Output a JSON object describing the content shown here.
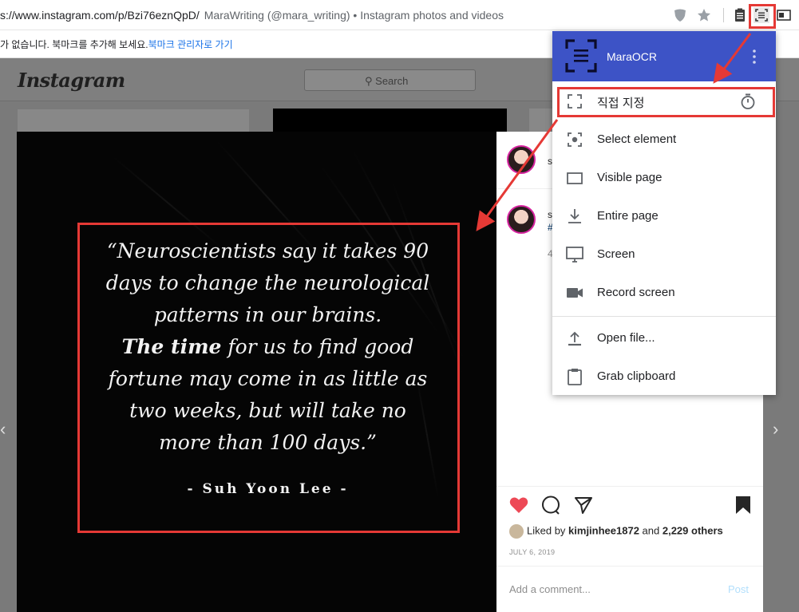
{
  "browser": {
    "url": "s://www.instagram.com/p/Bzi76eznQpD/",
    "page_title": "MaraWriting (@mara_writing) • Instagram photos and videos",
    "bookmark_message": "가 없습니다. 북마크를 추가해 보세요.",
    "bookmark_link": "북마크 관리자로 가기",
    "icons": [
      "shield-icon",
      "star-icon",
      "clipboard-icon",
      "maraocr-extension-icon",
      "window-icon"
    ]
  },
  "instagram": {
    "logo": "Instagram",
    "search_placeholder": "Search",
    "quote": {
      "line1": "“Neuroscientists say it takes 90",
      "line2": "days to change the neurological",
      "line3": "patterns in our brains.",
      "line4_bold": "The time",
      "line4_rest": " for us to find good",
      "line5": "fortune may come in as little as",
      "line6": "two weeks, but will take no",
      "line7": "more than 100 days.”",
      "author": "- Suh Yoon Lee -"
    },
    "side": {
      "user_initial_1": "s",
      "user_initial_2": "s",
      "hashtag_initial": "#",
      "count_initial": "4"
    },
    "likes": {
      "prefix": "Liked by ",
      "user": "kimjinhee1872",
      "middle": " and ",
      "count": "2,229 others"
    },
    "date": "JULY 6, 2019",
    "comment_placeholder": "Add a comment...",
    "post_button": "Post"
  },
  "popup": {
    "title": "MaraOCR",
    "items": [
      {
        "label": "직접 지정",
        "icon": "select-region-icon"
      },
      {
        "label": "Select element",
        "icon": "select-element-icon"
      },
      {
        "label": "Visible page",
        "icon": "visible-page-icon"
      },
      {
        "label": "Entire page",
        "icon": "download-icon"
      },
      {
        "label": "Screen",
        "icon": "monitor-icon"
      },
      {
        "label": "Record screen",
        "icon": "video-camera-icon"
      },
      {
        "label": "Open file...",
        "icon": "upload-icon"
      },
      {
        "label": "Grab clipboard",
        "icon": "clipboard-icon"
      }
    ],
    "highlight_color": "#e53935",
    "header_color": "#3d53c6"
  }
}
